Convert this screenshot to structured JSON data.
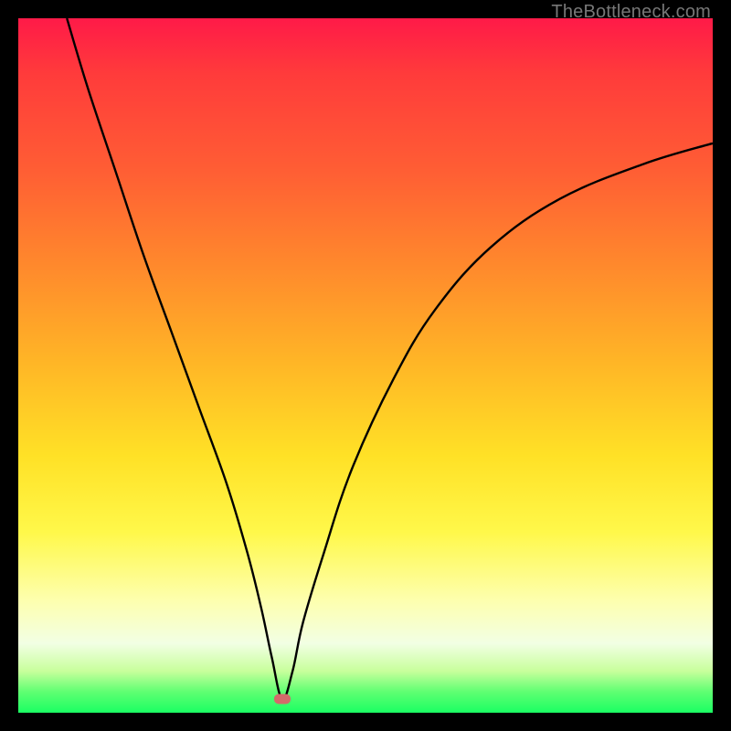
{
  "watermark": "TheBottleneck.com",
  "colors": {
    "background_black": "#000000",
    "curve": "#000000",
    "marker": "#d46a6a",
    "gradient_top": "#ff1a48",
    "gradient_mid_high": "#ff8a2c",
    "gradient_mid": "#ffe126",
    "gradient_mid_low": "#fdffb0",
    "gradient_bottom": "#1aff63"
  },
  "chart_data": {
    "type": "line",
    "title": "",
    "xlabel": "",
    "ylabel": "",
    "xlim": [
      0,
      100
    ],
    "ylim": [
      0,
      100
    ],
    "grid": false,
    "legend": false,
    "annotations": [
      "TheBottleneck.com"
    ],
    "marker": {
      "x": 38,
      "y": 2
    },
    "series": [
      {
        "name": "curve",
        "x": [
          7,
          10,
          14,
          18,
          22,
          26,
          30,
          33,
          35,
          36.5,
          38,
          39.5,
          41,
          44,
          48,
          54,
          60,
          68,
          78,
          90,
          100
        ],
        "values": [
          100,
          90,
          78,
          66,
          55,
          44,
          33,
          23,
          15,
          8,
          2,
          6,
          13,
          23,
          35,
          48,
          58,
          67,
          74,
          79,
          82
        ]
      }
    ]
  }
}
